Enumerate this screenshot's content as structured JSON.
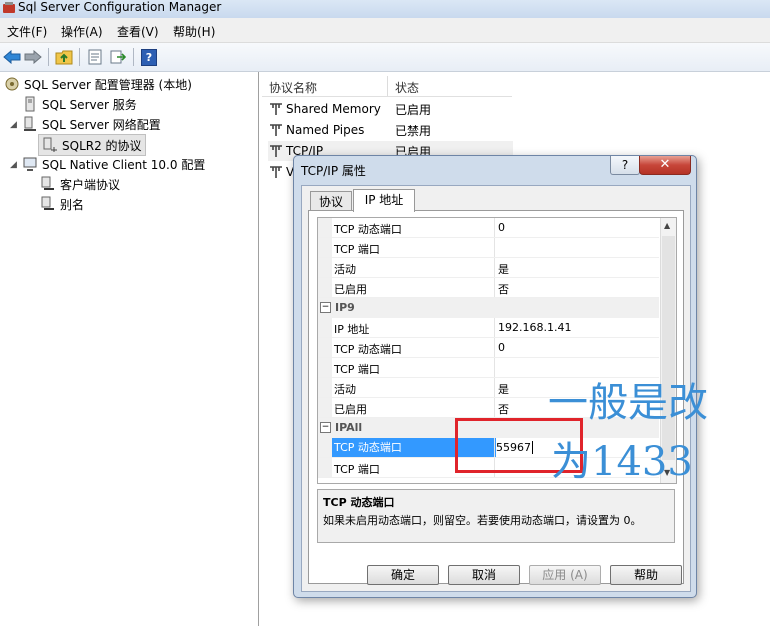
{
  "window": {
    "title": "Sql Server Configuration Manager"
  },
  "menu": [
    "文件(F)",
    "操作(A)",
    "查看(V)",
    "帮助(H)"
  ],
  "toolbar": {
    "icons": [
      "back-arrow-icon",
      "forward-arrow-icon",
      "up-folder-icon",
      "properties-icon",
      "export-icon",
      "help-icon"
    ],
    "help_glyph": "?"
  },
  "tree": {
    "root": "SQL Server 配置管理器 (本地)",
    "items": [
      {
        "label": "SQL Server 服务"
      },
      {
        "label": "SQL Server 网络配置"
      },
      {
        "label": "SQLR2 的协议"
      },
      {
        "label": "SQL Native Client 10.0 配置"
      },
      {
        "label": "客户端协议"
      },
      {
        "label": "别名"
      }
    ]
  },
  "list": {
    "columns": [
      "协议名称",
      "状态"
    ],
    "rows": [
      {
        "name": "Shared Memory",
        "status": "已启用"
      },
      {
        "name": "Named Pipes",
        "status": "已禁用"
      },
      {
        "name": "TCP/IP",
        "status": "已启用"
      },
      {
        "name": "V",
        "status": ""
      }
    ]
  },
  "dialog": {
    "title": "TCP/IP 属性",
    "help": "?",
    "close": "✕",
    "tabs": [
      "协议",
      "IP 地址"
    ],
    "rows_top": [
      {
        "name": "TCP 动态端口",
        "value": "0"
      },
      {
        "name": "TCP 端口",
        "value": ""
      },
      {
        "name": "活动",
        "value": "是"
      },
      {
        "name": "已启用",
        "value": "否"
      }
    ],
    "ip9": {
      "header": "IP9",
      "toggle": "−",
      "rows": [
        {
          "name": "IP 地址",
          "value": "192.168.1.41"
        },
        {
          "name": "TCP 动态端口",
          "value": "0"
        },
        {
          "name": "TCP 端口",
          "value": ""
        },
        {
          "name": "活动",
          "value": "是"
        },
        {
          "name": "已启用",
          "value": "否"
        }
      ]
    },
    "ipall": {
      "header": "IPAll",
      "toggle": "−",
      "rows": [
        {
          "name": "TCP 动态端口",
          "value": "55967"
        },
        {
          "name": "TCP 端口",
          "value": ""
        }
      ]
    },
    "description": {
      "title": "TCP 动态端口",
      "text": "如果未启用动态端口，则留空。若要使用动态端口，请设置为 0。"
    },
    "buttons": {
      "ok": "确定",
      "cancel": "取消",
      "apply": "应用 (A)",
      "help": "帮助"
    }
  },
  "annotation": {
    "line1": "一般是改",
    "line2": "为1433"
  },
  "colors": {
    "accent": "#3399ff",
    "highlight_box": "#e0242b",
    "annotation": "#3b8fd6"
  }
}
